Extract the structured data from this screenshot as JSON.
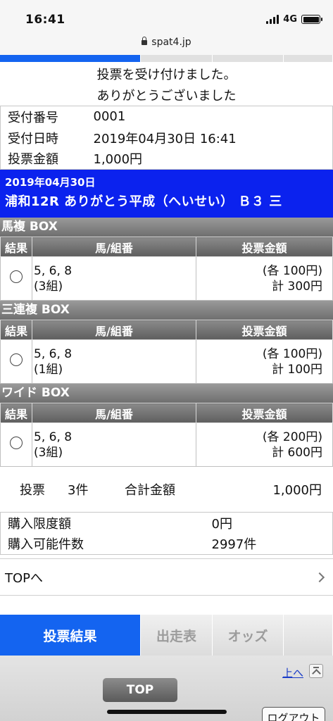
{
  "status_bar": {
    "time": "16:41",
    "network": "4G",
    "battery_level": 1.0
  },
  "browser": {
    "url": "spat4.jp"
  },
  "message": {
    "line1": "投票を受け付けました。",
    "line2": "ありがとうございました"
  },
  "receipt": [
    {
      "label": "受付番号",
      "value": "0001"
    },
    {
      "label": "受付日時",
      "value": "2019年04月30日 16:41"
    },
    {
      "label": "投票金額",
      "value": "1,000円"
    }
  ],
  "race": {
    "date": "2019年04月30日",
    "name": "浦和12R ありがとう平成（へいせい） Ｂ３ 三"
  },
  "table_headers": {
    "result": "結果",
    "combination": "馬/組番",
    "amount": "投票金額"
  },
  "bets": [
    {
      "type": "馬複 BOX",
      "horses": "5, 6, 8",
      "combos": "(3組)",
      "per": "(各 100円)",
      "total": "計 300円"
    },
    {
      "type": "三連複 BOX",
      "horses": "5, 6, 8",
      "combos": "(1組)",
      "per": "(各 100円)",
      "total": "計 100円"
    },
    {
      "type": "ワイド BOX",
      "horses": "5, 6, 8",
      "combos": "(3組)",
      "per": "(各 200円)",
      "total": "計 600円"
    }
  ],
  "summary": {
    "label": "投票",
    "count": "3件",
    "total_label": "合計金額",
    "total": "1,000円"
  },
  "limits": [
    {
      "label": "購入限度額",
      "value": "0円"
    },
    {
      "label": "購入可能件数",
      "value": "2997件"
    }
  ],
  "top_link": "TOPへ",
  "bottom_tabs": {
    "results": "投票結果",
    "entries": "出走表",
    "odds": "オッズ"
  },
  "footer": {
    "up": "上へ",
    "top_button": "TOP",
    "logout": "ログアウト"
  }
}
